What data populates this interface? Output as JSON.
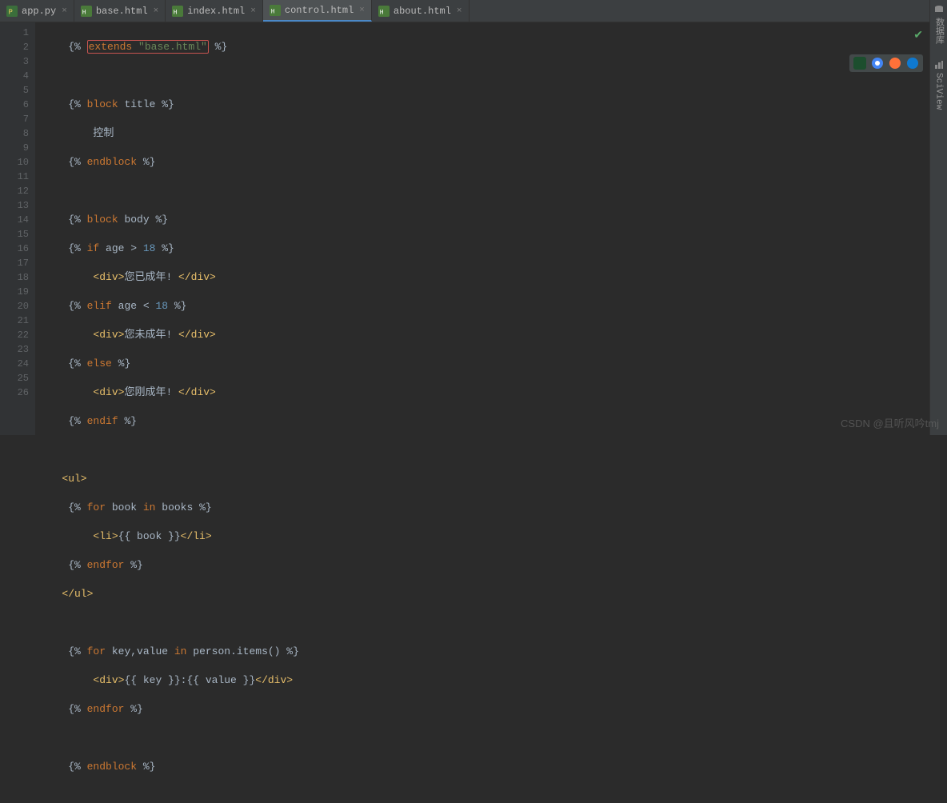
{
  "tabs": [
    {
      "label": "app.py",
      "type": "py"
    },
    {
      "label": "base.html",
      "type": "html"
    },
    {
      "label": "index.html",
      "type": "html"
    },
    {
      "label": "control.html",
      "type": "html",
      "active": true
    },
    {
      "label": "about.html",
      "type": "html"
    }
  ],
  "side": {
    "db": "数据库",
    "sci": "SciView"
  },
  "gutter": [
    "1",
    "2",
    "3",
    "4",
    "5",
    "6",
    "7",
    "8",
    "9",
    "10",
    "11",
    "12",
    "13",
    "14",
    "15",
    "16",
    "17",
    "18",
    "19",
    "20",
    "21",
    "22",
    "23",
    "24",
    "25",
    "26"
  ],
  "code": {
    "l1_open": "{% ",
    "l1_kw": "extends ",
    "l1_str": "\"base.html\"",
    "l1_close": " %}",
    "l3": "{% ",
    "l3kw": "block ",
    "l3id": "title ",
    "l3c": "%}",
    "l4": "控制",
    "l5": "{% ",
    "l5kw": "endblock ",
    "l5c": "%}",
    "l7": "{% ",
    "l7kw": "block ",
    "l7id": "body ",
    "l7c": "%}",
    "l8": "{% ",
    "l8kw": "if ",
    "l8v": "age > ",
    "l8n": "18 ",
    "l8c": "%}",
    "l9a": "<div>",
    "l9t": "您已成年! ",
    "l9b": "</div>",
    "l10": "{% ",
    "l10kw": "elif ",
    "l10v": "age < ",
    "l10n": "18 ",
    "l10c": "%}",
    "l11a": "<div>",
    "l11t": "您未成年! ",
    "l11b": "</div>",
    "l12": "{% ",
    "l12kw": "else ",
    "l12c": "%}",
    "l13a": "<div>",
    "l13t": "您刚成年! ",
    "l13b": "</div>",
    "l14": "{% ",
    "l14kw": "endif ",
    "l14c": "%}",
    "l16": "<ul>",
    "l17": "{% ",
    "l17kw": "for ",
    "l17v": "book ",
    "l17in": "in ",
    "l17s": "books ",
    "l17c": "%}",
    "l18a": "<li>",
    "l18e": "{{ book }}",
    "l18b": "</li>",
    "l19": "{% ",
    "l19kw": "endfor ",
    "l19c": "%}",
    "l20": "</ul>",
    "l22": "{% ",
    "l22kw": "for ",
    "l22v": "key,value ",
    "l22in": "in ",
    "l22s": "person.items() ",
    "l22c": "%}",
    "l23a": "<div>",
    "l23e": "{{ key }}:{{ value }}",
    "l23b": "</div>",
    "l24": "{% ",
    "l24kw": "endfor ",
    "l24c": "%}",
    "l26": "{% ",
    "l26kw": "endblock ",
    "l26c": "%}"
  },
  "watermark": "CSDN @且听风吟tmj"
}
